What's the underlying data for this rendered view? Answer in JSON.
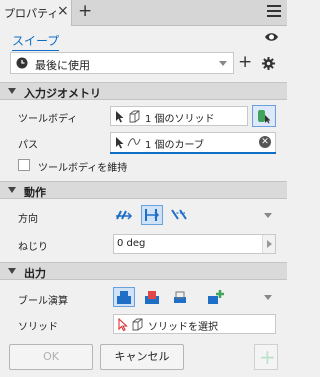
{
  "panel": {
    "tab_label": "プロパティ",
    "tab_close": "×",
    "tab_add": "+",
    "menu_icon": "hamburger-menu-icon"
  },
  "header": {
    "feature_name": "スイープ",
    "preset_value": "最後に使用",
    "add_preset": "+",
    "icons": [
      "eye-icon",
      "gear-icon",
      "history-icon"
    ]
  },
  "sections": {
    "input_geometry": {
      "title": "入力ジオメトリ",
      "tool_body_label": "ツールボディ",
      "tool_body_value": "1 個のソリッド",
      "path_label": "パス",
      "path_value": "1 個のカーブ",
      "keep_tool_body_label": "ツールボディを維持",
      "keep_tool_body_checked": false
    },
    "behavior": {
      "title": "動作",
      "direction_label": "方向",
      "twist_label": "ねじり",
      "twist_value": "0 deg",
      "selected_direction_index": 1
    },
    "output": {
      "title": "出力",
      "boolean_label": "ブール演算",
      "solid_label": "ソリッド",
      "solid_value": "ソリッドを選択",
      "selected_boolean_index": 0
    }
  },
  "footer": {
    "ok_label": "OK",
    "cancel_label": "キャンセル",
    "ok_enabled": false
  },
  "colors": {
    "accent": "#0f6fc6",
    "section_bg": "#dadada",
    "panel_bg": "#f0f0f0"
  }
}
